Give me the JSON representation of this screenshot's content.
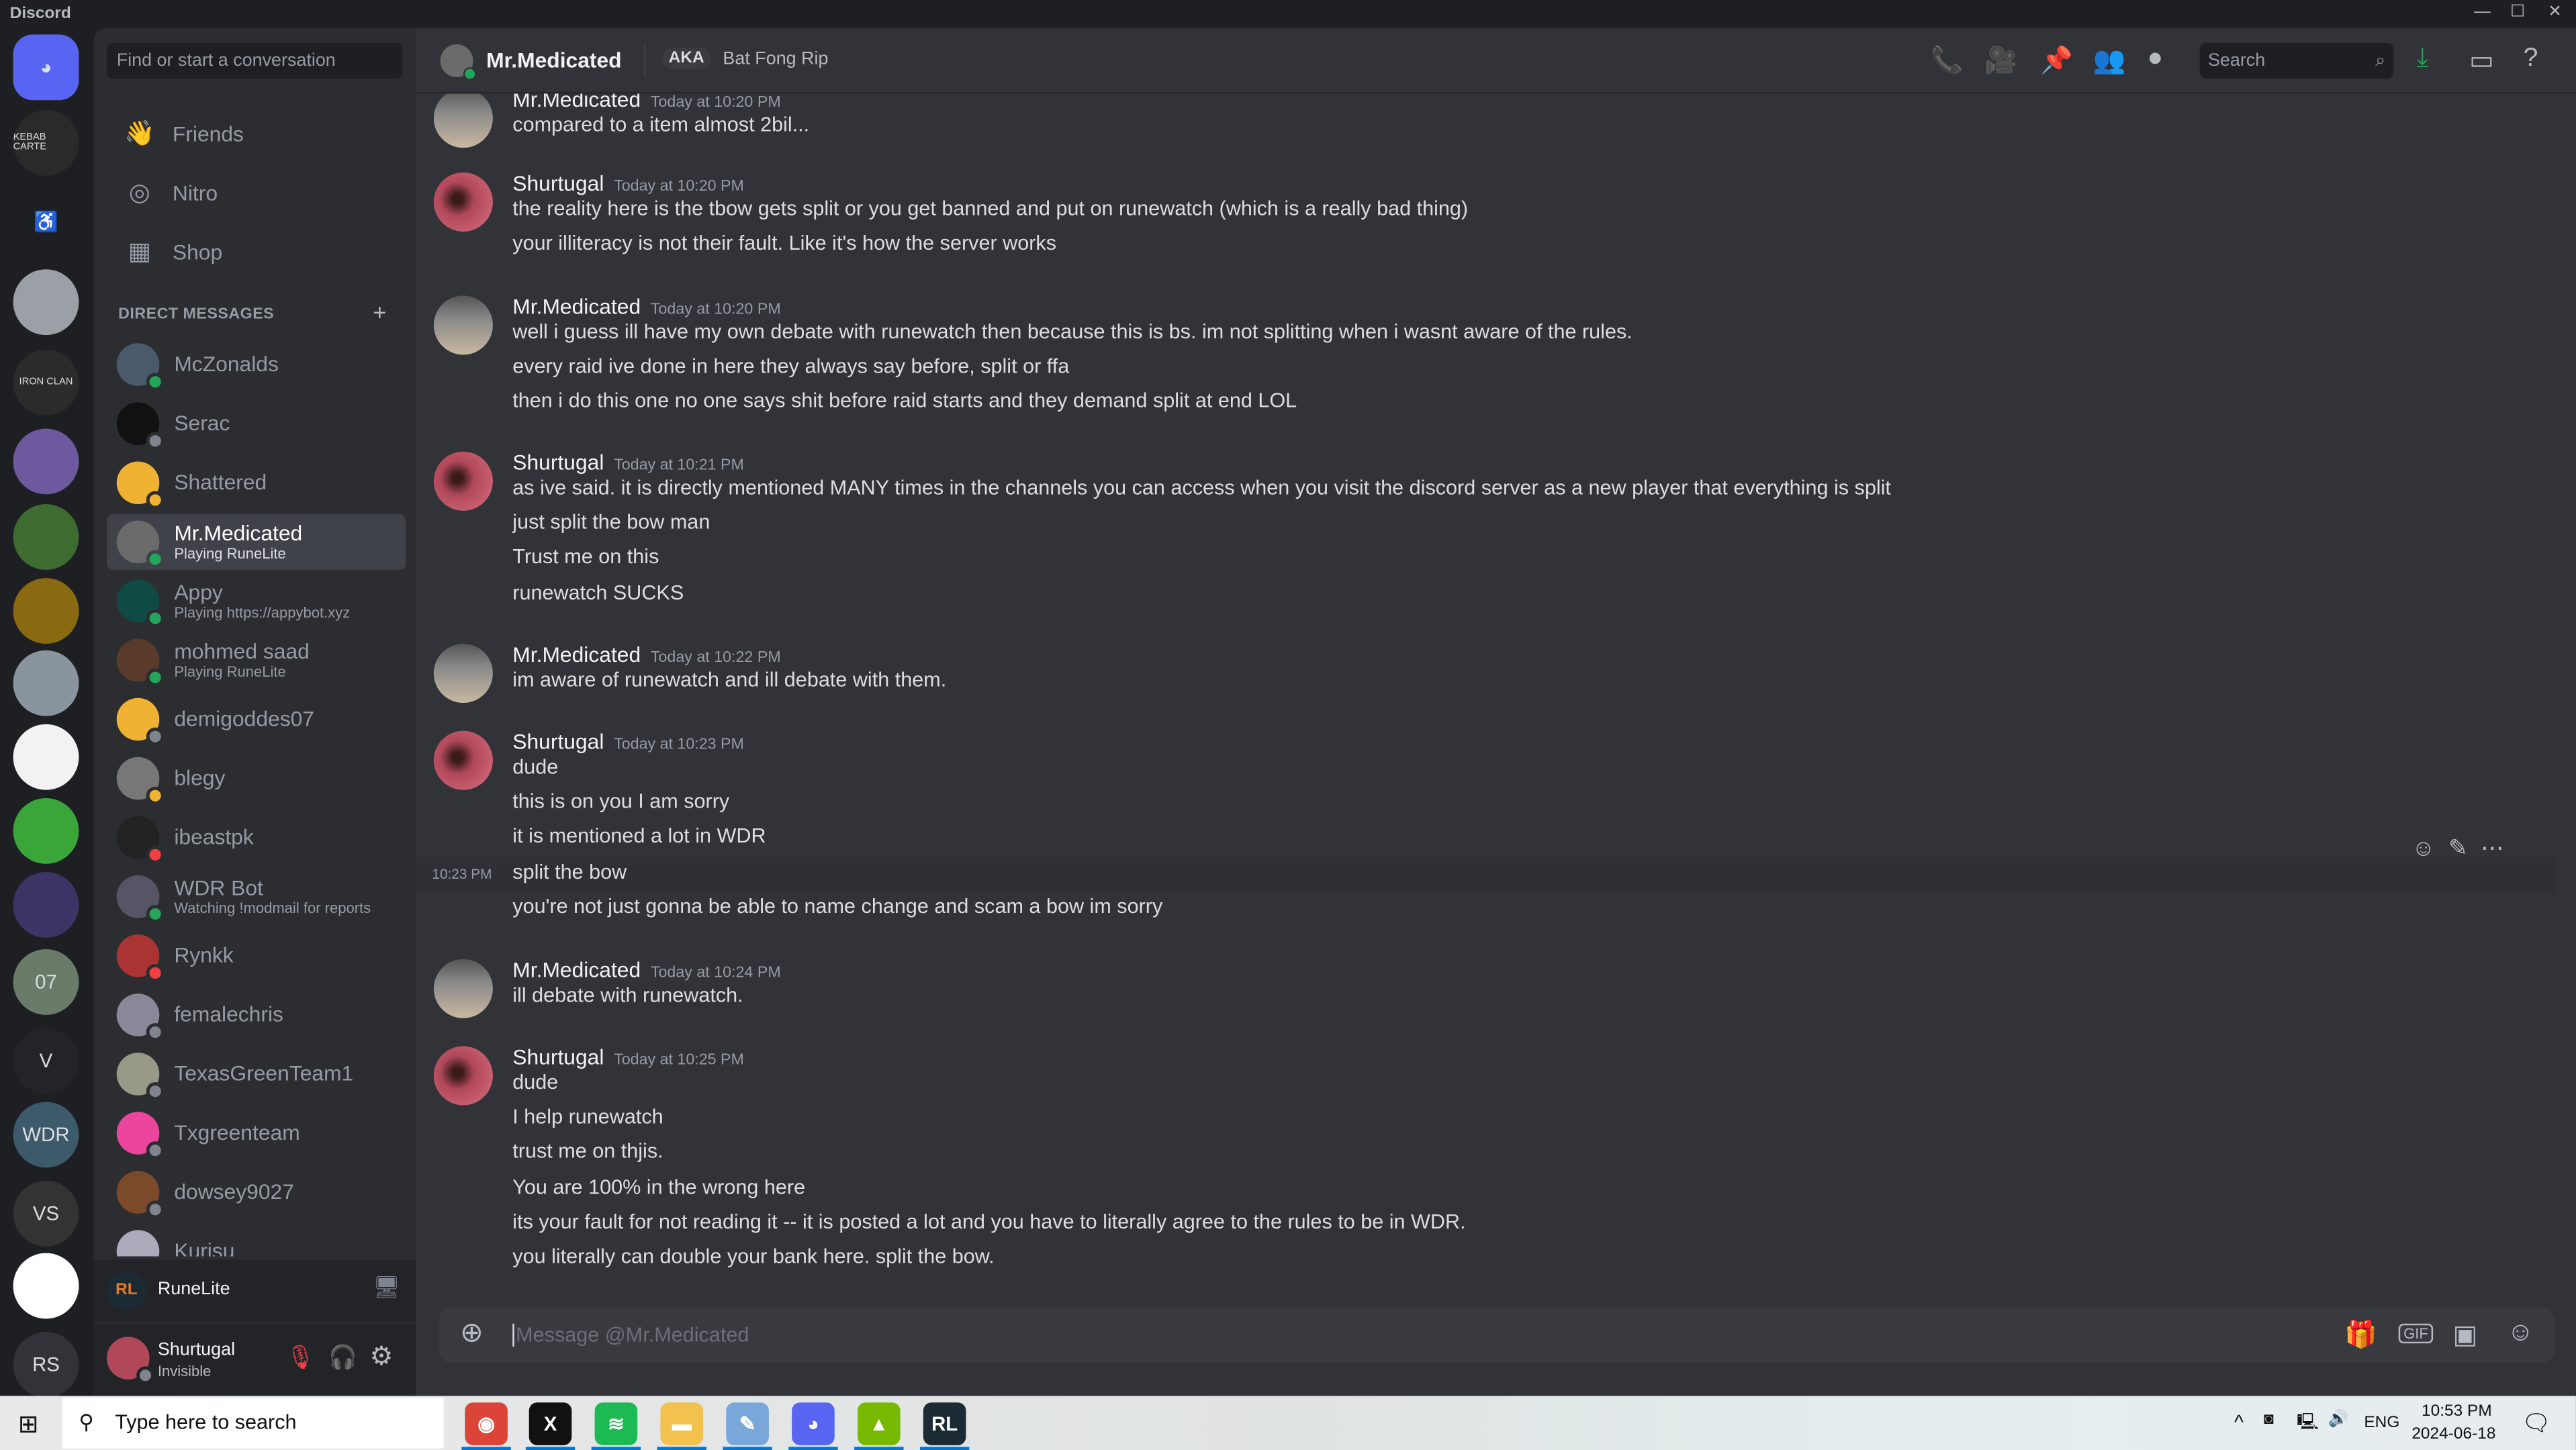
{
  "app": {
    "title": "Discord"
  },
  "servers": [
    {
      "label": "",
      "color": "#5865f2",
      "icon": "discord-home-icon"
    },
    {
      "label": "KEBAB CARTE",
      "color": "#2a2a2a"
    },
    {
      "label": "♿",
      "color": "#1e1f22"
    },
    {
      "label": "",
      "color": "#9aa0a6"
    },
    {
      "label": "IRON CLAN",
      "color": "#2b2b2b"
    },
    {
      "label": "",
      "color": "#6d5a9e"
    },
    {
      "label": "",
      "color": "#3e6b2f"
    },
    {
      "label": "",
      "color": "#8a6a10"
    },
    {
      "label": "",
      "color": "#8a949e"
    },
    {
      "label": "",
      "color": "#f2f2f2"
    },
    {
      "label": "",
      "color": "#3aa63a"
    },
    {
      "label": "",
      "color": "#3b3566"
    },
    {
      "label": "07",
      "color": "#6b7b6a"
    },
    {
      "label": "V",
      "color": "#232428"
    },
    {
      "label": "WDR",
      "color": "#3d5a6a"
    },
    {
      "label": "VS",
      "color": "#333"
    },
    {
      "label": "",
      "color": "#ffffff"
    },
    {
      "label": "RS",
      "color": "#313338"
    }
  ],
  "sidebar": {
    "search_placeholder": "Find or start a conversation",
    "nav": [
      {
        "label": "Friends",
        "icon": "friends-icon"
      },
      {
        "label": "Nitro",
        "icon": "nitro-icon"
      },
      {
        "label": "Shop",
        "icon": "shop-icon"
      }
    ],
    "dm_header": "DIRECT MESSAGES",
    "dms": [
      {
        "name": "McZonalds",
        "status": "",
        "presence": "mobile",
        "color": "#4a5a6a"
      },
      {
        "name": "Serac",
        "status": "",
        "presence": "offline",
        "color": "#111"
      },
      {
        "name": "Shattered",
        "status": "",
        "presence": "idle",
        "color": "#f0b232"
      },
      {
        "name": "Mr.Medicated",
        "status": "Playing RuneLite",
        "presence": "online",
        "color": "#6b6b6b",
        "active": true
      },
      {
        "name": "Appy",
        "status": "Playing https://appybot.xyz",
        "presence": "online",
        "color": "#0f4a45"
      },
      {
        "name": "mohmed saad",
        "status": "Playing RuneLite",
        "presence": "online",
        "color": "#5a3a2a"
      },
      {
        "name": "demigoddes07",
        "status": "",
        "presence": "offline",
        "color": "#f0b232"
      },
      {
        "name": "blegy",
        "status": "",
        "presence": "idle",
        "color": "#777"
      },
      {
        "name": "ibeastpk",
        "status": "",
        "presence": "dnd",
        "color": "#222"
      },
      {
        "name": "WDR Bot",
        "status": "Watching !modmail for reports",
        "presence": "online",
        "color": "#556"
      },
      {
        "name": "Rynkk",
        "status": "",
        "presence": "dnd",
        "color": "#a33"
      },
      {
        "name": "femalechris",
        "status": "",
        "presence": "offline",
        "color": "#889"
      },
      {
        "name": "TexasGreenTeam1",
        "status": "",
        "presence": "offline",
        "color": "#998"
      },
      {
        "name": "Txgreenteam",
        "status": "",
        "presence": "offline",
        "color": "#eb459e"
      },
      {
        "name": "dowsey9027",
        "status": "",
        "presence": "offline",
        "color": "#7a4a2a"
      },
      {
        "name": "Kurisu",
        "status": "",
        "presence": "offline",
        "color": "#aab"
      }
    ],
    "activity": {
      "name": "RuneLite"
    },
    "user": {
      "name": "Shurtugal",
      "status": "Invisible"
    }
  },
  "header": {
    "name": "Mr.Medicated",
    "aka_label": "AKA",
    "aka": "Bat Fong Rip",
    "search_placeholder": "Search"
  },
  "colors": {
    "online": "#23a55a",
    "idle": "#f0b232",
    "dnd": "#f23f43",
    "offline": "#80848e",
    "download": "#23a55a"
  },
  "messages": [
    {
      "author": "Mr.Medicated",
      "timestamp": "Today at 10:20 PM",
      "lines": [
        "compared to a item almost 2bil..."
      ]
    },
    {
      "author": "Shurtugal",
      "timestamp": "Today at 10:20 PM",
      "lines": [
        "the reality here is the tbow gets split or you get banned and put on runewatch (which is a really bad thing)",
        "your illiteracy is not their fault. Like it's how the server works"
      ]
    },
    {
      "author": "Mr.Medicated",
      "timestamp": "Today at 10:20 PM",
      "lines": [
        "well i guess ill have my own debate with runewatch then because this is bs. im not splitting when i wasnt aware of the rules.",
        "every raid ive done in here they always say before, split or ffa",
        "then i do this one no one says shit before raid starts and they demand split at end LOL"
      ]
    },
    {
      "author": "Shurtugal",
      "timestamp": "Today at 10:21 PM",
      "lines": [
        "as ive said. it is directly mentioned MANY times in the channels you can access when you visit the discord server as a new player that everything is split",
        "just split the bow man",
        "Trust me on this",
        "runewatch SUCKS"
      ]
    },
    {
      "author": "Mr.Medicated",
      "timestamp": "Today at 10:22 PM",
      "lines": [
        "im aware of runewatch and ill debate with them."
      ]
    },
    {
      "author": "Shurtugal",
      "timestamp": "Today at 10:23 PM",
      "lines": [
        "dude",
        "this is on you I am sorry",
        "it is mentioned a lot in WDR",
        "split the bow",
        "you're not just gonna be able to name change and scam a bow im sorry"
      ],
      "hover_time": "10:23 PM"
    },
    {
      "author": "Mr.Medicated",
      "timestamp": "Today at 10:24 PM",
      "lines": [
        "ill debate with runewatch."
      ]
    },
    {
      "author": "Shurtugal",
      "timestamp": "Today at 10:25 PM",
      "lines": [
        "dude",
        "I help runewatch",
        "trust me on thjis.",
        "You are 100% in the wrong here",
        "its your fault for not reading it -- it is posted a lot and you have to literally agree to the rules to be in WDR.",
        "you literally can double your bank here. split the bow."
      ]
    }
  ],
  "composer": {
    "placeholder": "Message @Mr.Medicated"
  },
  "taskbar": {
    "search_placeholder": "Type here to search",
    "apps": [
      "Chrome",
      "X",
      "Spotify",
      "File Explorer",
      "Paint",
      "Discord",
      "NVIDIA",
      "RuneLite"
    ],
    "lang": "ENG",
    "time": "10:53 PM",
    "date": "2024-06-18"
  }
}
